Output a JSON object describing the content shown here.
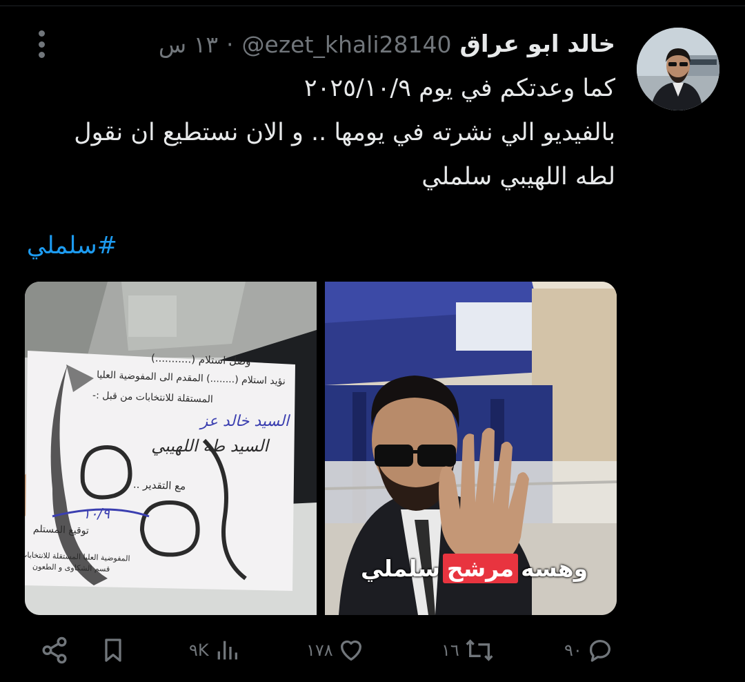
{
  "tweet": {
    "author_name": "خالد ابو عراق",
    "handle": "@ezet_khali28140",
    "separator": "·",
    "time": "١٣ س",
    "text_lines": [
      "كما وعدتكم في يوم ٢٠٢٥/١٠/٩",
      "بالفيديو الي نشرته في يومها .. و الان نستطيع ان نقول",
      "لطه اللهيبي سلملي"
    ],
    "hashtag": "#سلملي"
  },
  "media": {
    "receipt": {
      "line1": "وصل استلام (...........)",
      "line2": "نؤيد استلام (........) المقدم الى المفوضية العليا",
      "line3": "المستقلة للانتخابات من قبل :-",
      "line4": "مع التقدير ..",
      "line5": "توقيع المستلم",
      "footer1": "المفوضية العليا المستقلة للانتخابات",
      "footer2": "قسم الشكاوى و الطعون",
      "hand1": "السيد خالد عز",
      "hand2": "السيد طه اللهيبي",
      "hand3": "١٠/٩"
    },
    "video_caption": {
      "part1": "وهسه",
      "part2": "مرشح",
      "part3": "سلملي"
    }
  },
  "actions": {
    "replies": "٩٠",
    "reposts": "١٦",
    "likes": "١٧٨",
    "views": "٩K"
  },
  "colors": {
    "background": "#000000",
    "text": "#e7e9ea",
    "muted": "#71767b",
    "link": "#1d9bf0",
    "caption_highlight": "#e8343f"
  }
}
